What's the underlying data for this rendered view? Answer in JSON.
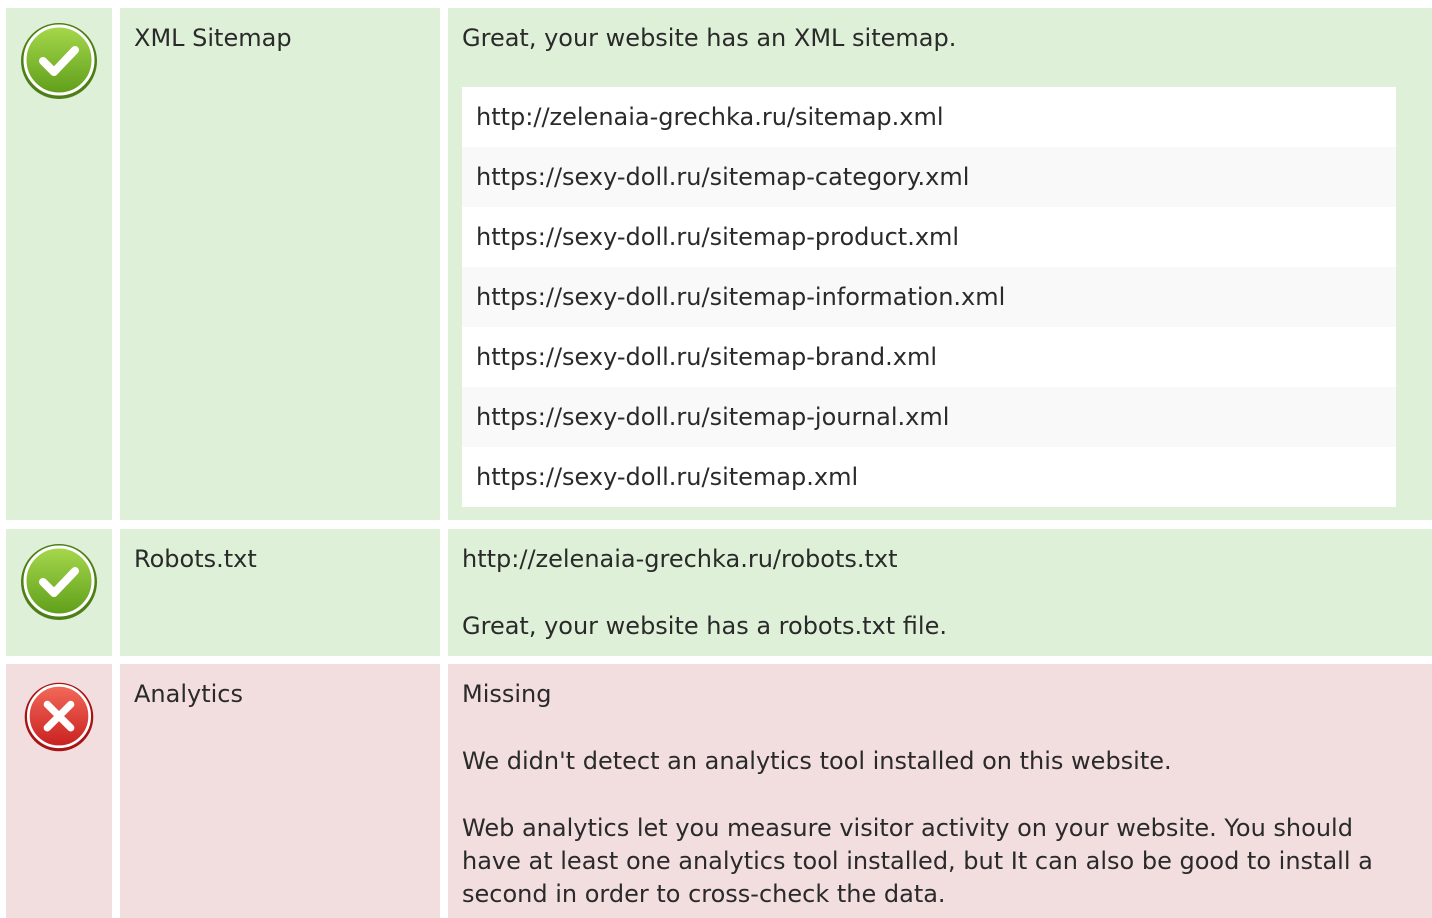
{
  "sitemap": {
    "status": "pass",
    "name": "XML Sitemap",
    "message": "Great, your website has an XML sitemap.",
    "urls": [
      "http://zelenaia-grechka.ru/sitemap.xml",
      "https://sexy-doll.ru/sitemap-category.xml",
      "https://sexy-doll.ru/sitemap-product.xml",
      "https://sexy-doll.ru/sitemap-information.xml",
      "https://sexy-doll.ru/sitemap-brand.xml",
      "https://sexy-doll.ru/sitemap-journal.xml",
      "https://sexy-doll.ru/sitemap.xml"
    ]
  },
  "robots": {
    "status": "pass",
    "name": "Robots.txt",
    "url": "http://zelenaia-grechka.ru/robots.txt",
    "message": "Great, your website has a robots.txt file."
  },
  "analytics": {
    "status": "fail",
    "name": "Analytics",
    "state": "Missing",
    "message": "We didn't detect an analytics tool installed on this website.",
    "description": "Web analytics let you measure visitor activity on your website. You should have at least one analytics tool installed, but It can also be good to install a second in order to cross-check the data."
  },
  "colors": {
    "pass_bg": "#dff0d8",
    "fail_bg": "#f2dede",
    "pass_icon": "#7cbc2a",
    "fail_icon": "#e23636"
  },
  "icons": {
    "pass": "check-circle-icon",
    "fail": "x-circle-icon"
  }
}
